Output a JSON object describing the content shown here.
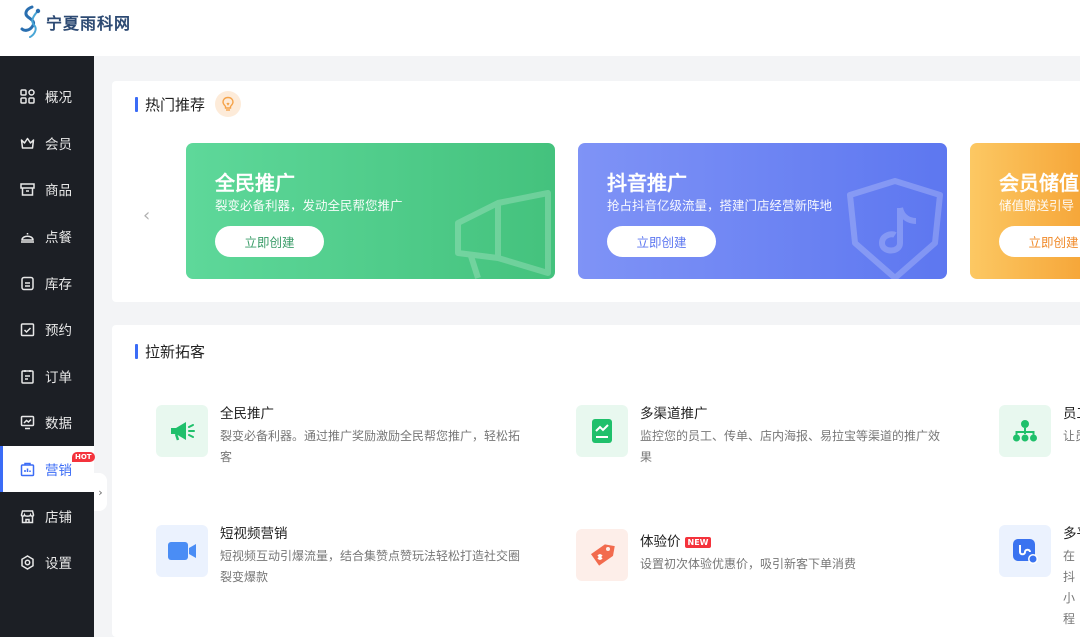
{
  "brand": {
    "name": "宁夏雨科网"
  },
  "sidebar": {
    "items": [
      {
        "label": "概况",
        "icon": "dashboard-icon"
      },
      {
        "label": "会员",
        "icon": "crown-icon"
      },
      {
        "label": "商品",
        "icon": "product-icon"
      },
      {
        "label": "点餐",
        "icon": "dish-icon"
      },
      {
        "label": "库存",
        "icon": "inventory-icon"
      },
      {
        "label": "预约",
        "icon": "calendar-check-icon"
      },
      {
        "label": "订单",
        "icon": "order-icon"
      },
      {
        "label": "数据",
        "icon": "data-icon"
      },
      {
        "label": "营销",
        "icon": "marketing-icon",
        "active": true,
        "badge": "HOT"
      },
      {
        "label": "店铺",
        "icon": "store-icon"
      },
      {
        "label": "设置",
        "icon": "settings-icon"
      }
    ],
    "accent": "#3b6cf6"
  },
  "hot_section": {
    "title": "热门推荐",
    "cards": [
      {
        "title": "全民推广",
        "desc": "裂变必备利器，发动全民帮您推广",
        "button": "立即创建",
        "color": "#4ecb8a"
      },
      {
        "title": "抖音推广",
        "desc": "抢占抖音亿级流量，搭建门店经营新阵地",
        "button": "立即创建",
        "color": "#6b83f3"
      },
      {
        "title": "会员储值",
        "desc": "储值赠送引导",
        "button": "立即创建",
        "color": "#f8b449"
      }
    ]
  },
  "acquire_section": {
    "title": "拉新拓客",
    "items": [
      {
        "name": "全民推广",
        "desc": "裂变必备利器。通过推广奖励激励全民帮您推广，轻松拓客",
        "icon": "megaphone-icon",
        "color": "#1fc06b"
      },
      {
        "name": "多渠道推广",
        "desc": "监控您的员工、传单、店内海报、易拉宝等渠道的推广效果",
        "icon": "channel-chart-icon",
        "color": "#1fc06b"
      },
      {
        "name": "员工",
        "desc": "让员",
        "icon": "org-tree-icon",
        "color": "#1fc06b"
      },
      {
        "name": "短视频营销",
        "desc": "短视频互动引爆流量，结合集赞点赞玩法轻松打造社交圈裂变爆款",
        "icon": "video-camera-icon",
        "color": "#4a8df5"
      },
      {
        "name": "体验价",
        "desc": "设置初次体验优惠价，吸引新客下单消费",
        "icon": "price-tag-icon",
        "color": "#f26b4e",
        "badge": "NEW"
      },
      {
        "name": "多平",
        "desc": "在抖小程",
        "icon": "miniapp-link-icon",
        "color": "#3a73f0"
      }
    ]
  }
}
